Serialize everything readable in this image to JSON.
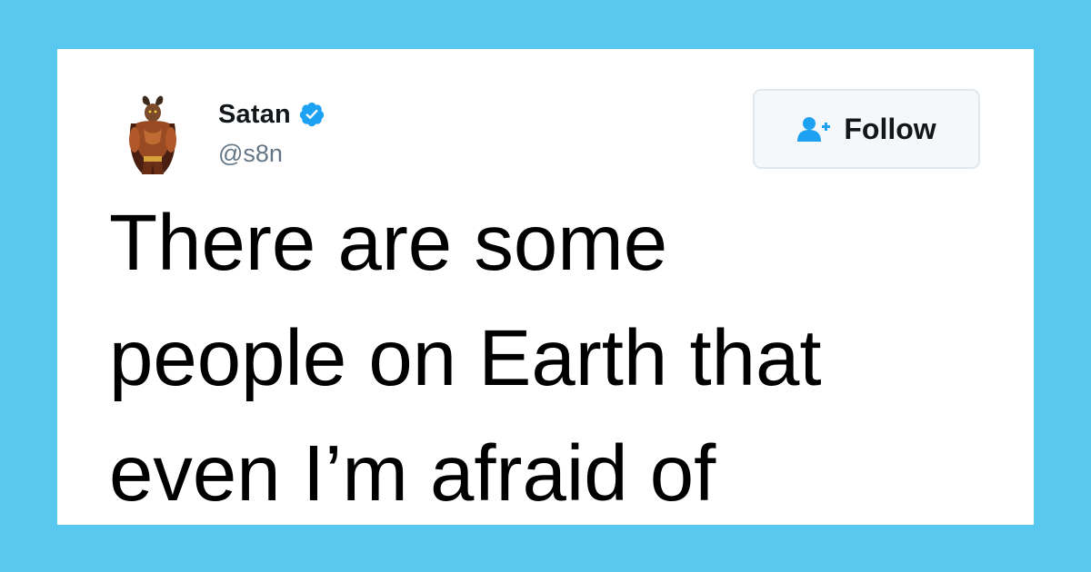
{
  "theme": {
    "background": "#58c8ee",
    "card": "#ffffff",
    "verified_color": "#1da1f2",
    "text_secondary": "#657786"
  },
  "tweet": {
    "author": {
      "display_name": "Satan",
      "handle": "@s8n",
      "verified": true,
      "avatar_icon": "devil-figure-avatar"
    },
    "follow_button": {
      "label": "Follow",
      "icon": "add-user-icon"
    },
    "text_lines": [
      "There are some",
      "people on Earth that",
      "even I’m afraid of"
    ]
  }
}
